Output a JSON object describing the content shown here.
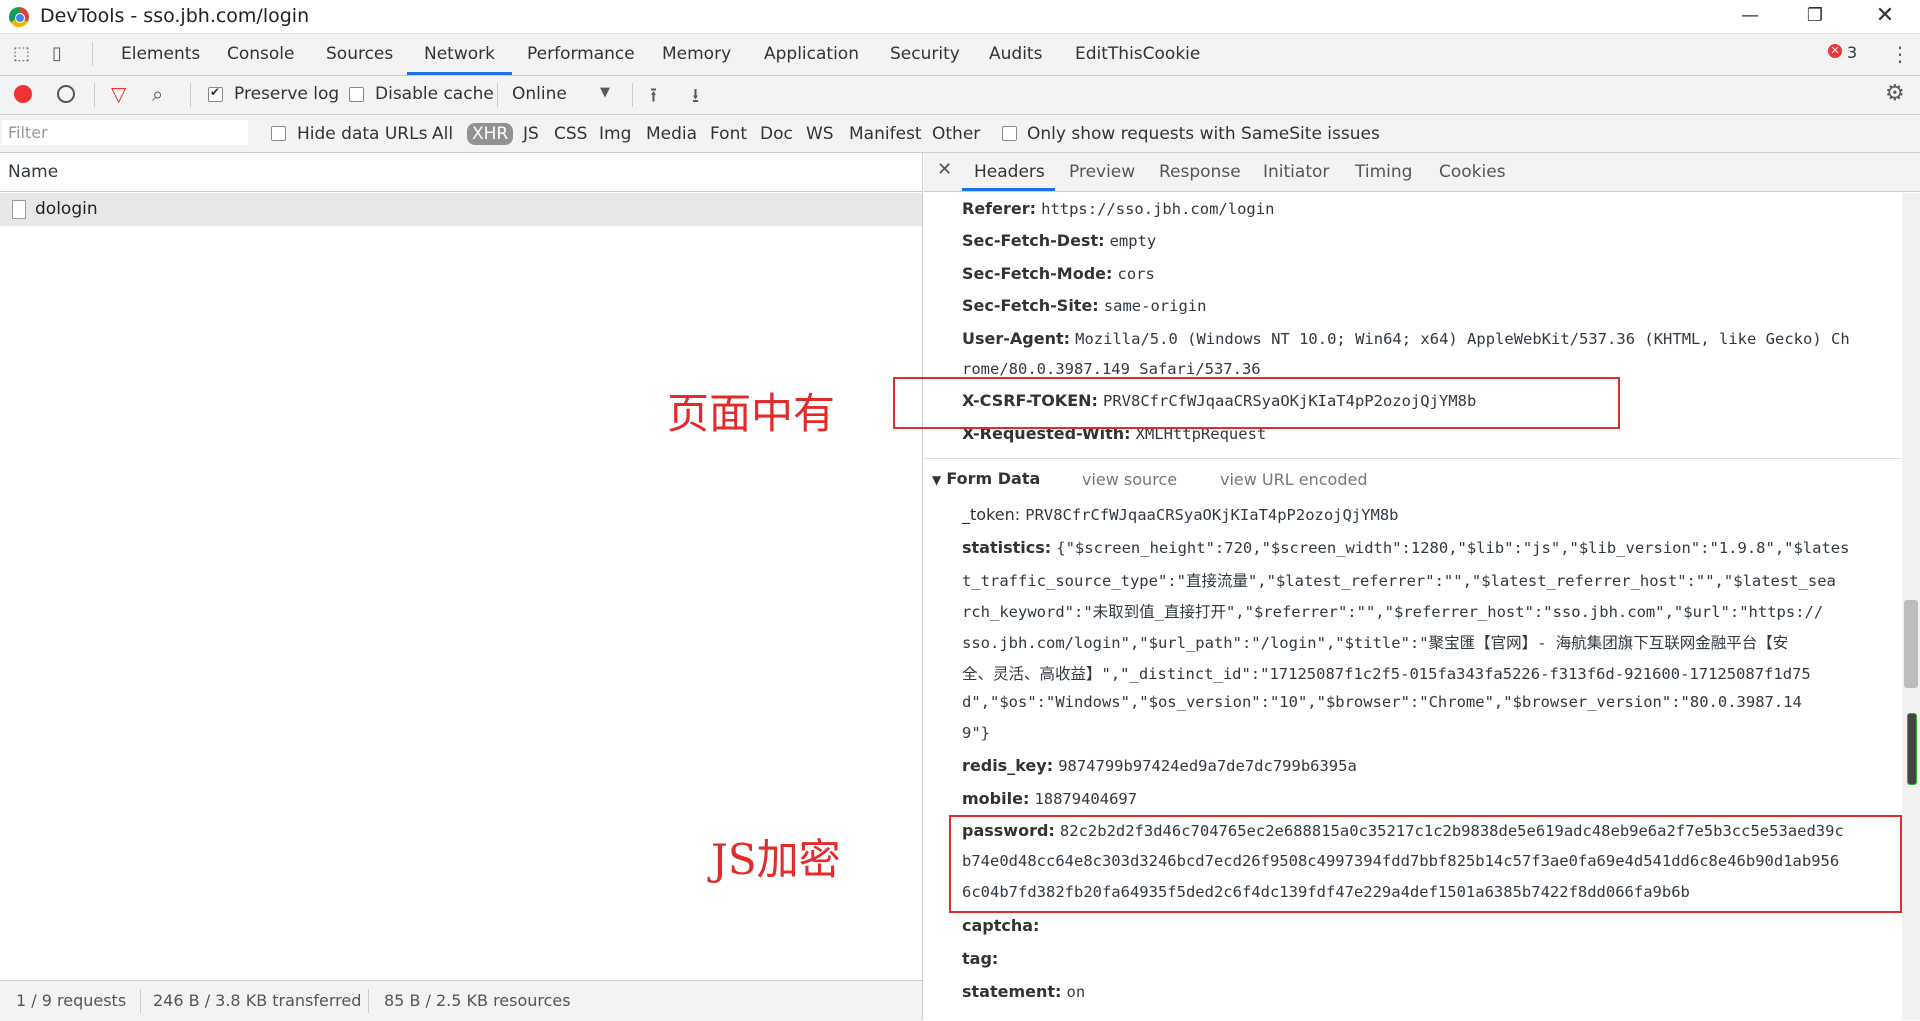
{
  "window": {
    "title": "DevTools - sso.jbh.com/login"
  },
  "panels": [
    "Elements",
    "Console",
    "Sources",
    "Network",
    "Performance",
    "Memory",
    "Application",
    "Security",
    "Audits",
    "EditThisCookie"
  ],
  "active_panel": "Network",
  "error_count": "3",
  "toolbar": {
    "preserve_log": "Preserve log",
    "disable_cache": "Disable cache",
    "throttle": "Online"
  },
  "filter": {
    "placeholder": "Filter",
    "hide_data_urls": "Hide data URLs",
    "types": [
      "All",
      "XHR",
      "JS",
      "CSS",
      "Img",
      "Media",
      "Font",
      "Doc",
      "WS",
      "Manifest",
      "Other"
    ],
    "selected_type": "XHR",
    "samesite": "Only show requests with SameSite issues"
  },
  "requests": {
    "column": "Name",
    "rows": [
      {
        "name": "dologin"
      }
    ]
  },
  "status": {
    "requests": "1 / 9 requests",
    "transferred": "246 B / 3.8 KB transferred",
    "resources": "85 B / 2.5 KB resources"
  },
  "annotations": {
    "token_note": "页面中有",
    "js_note": "JS加密"
  },
  "details": {
    "tabs": [
      "Headers",
      "Preview",
      "Response",
      "Initiator",
      "Timing",
      "Cookies"
    ],
    "active_tab": "Headers",
    "headers": [
      {
        "k": "Referer:",
        "v": "https://sso.jbh.com/login"
      },
      {
        "k": "Sec-Fetch-Dest:",
        "v": "empty"
      },
      {
        "k": "Sec-Fetch-Mode:",
        "v": "cors"
      },
      {
        "k": "Sec-Fetch-Site:",
        "v": "same-origin"
      },
      {
        "k": "User-Agent:",
        "v": "Mozilla/5.0 (Windows NT 10.0; Win64; x64) AppleWebKit/537.36 (KHTML, like Gecko) Ch"
      },
      {
        "k": "",
        "v": "rome/80.0.3987.149 Safari/537.36"
      },
      {
        "k": "X-CSRF-TOKEN:",
        "v": "PRV8CfrCfWJqaaCRSyaOKjKIaT4pP2ozojQjYM8b"
      },
      {
        "k": "X-Requested-With:",
        "v": "XMLHttpRequest"
      }
    ],
    "form_section": "Form Data",
    "view_source": "view source",
    "view_url_encoded": "view URL encoded",
    "form": {
      "token_k": "_token:",
      "token_v": "PRV8CfrCfWJqaaCRSyaOKjKIaT4pP2ozojQjYM8b",
      "statistics_k": "statistics:",
      "statistics_lines": [
        "{\"$screen_height\":720,\"$screen_width\":1280,\"$lib\":\"js\",\"$lib_version\":\"1.9.8\",\"$lates",
        "t_traffic_source_type\":\"直接流量\",\"$latest_referrer\":\"\",\"$latest_referrer_host\":\"\",\"$latest_sea",
        "rch_keyword\":\"未取到值_直接打开\",\"$referrer\":\"\",\"$referrer_host\":\"sso.jbh.com\",\"$url\":\"https://",
        "sso.jbh.com/login\",\"$url_path\":\"/login\",\"$title\":\"聚宝匯【官网】- 海航集团旗下互联网金融平台【安",
        "全、灵活、高收益】\",\"_distinct_id\":\"17125087f1c2f5-015fa343fa5226-f313f6d-921600-17125087f1d75",
        "d\",\"$os\":\"Windows\",\"$os_version\":\"10\",\"$browser\":\"Chrome\",\"$browser_version\":\"80.0.3987.14",
        "9\"}"
      ],
      "redis_k": "redis_key:",
      "redis_v": "9874799b97424ed9a7de7dc799b6395a",
      "mobile_k": "mobile:",
      "mobile_v": "18879404697",
      "password_k": "password:",
      "password_lines": [
        "82c2b2d2f3d46c704765ec2e688815a0c35217c1c2b9838de5e619adc48eb9e6a2f7e5b3cc5e53aed39c",
        "b74e0d48cc64e8c303d3246bcd7ecd26f9508c4997394fdd7bbf825b14c57f3ae0fa69e4d541dd6c8e46b90d1ab956",
        "6c04b7fd382fb20fa64935f5ded2c6f4dc139fdf47e229a4def1501a6385b7422f8dd066fa9b6b"
      ],
      "captcha_k": "captcha:",
      "tag_k": "tag:",
      "statement_k": "statement:",
      "statement_v": "on"
    }
  },
  "colors": {
    "accent": "#1a73e8",
    "annotation": "#e32b2b"
  }
}
